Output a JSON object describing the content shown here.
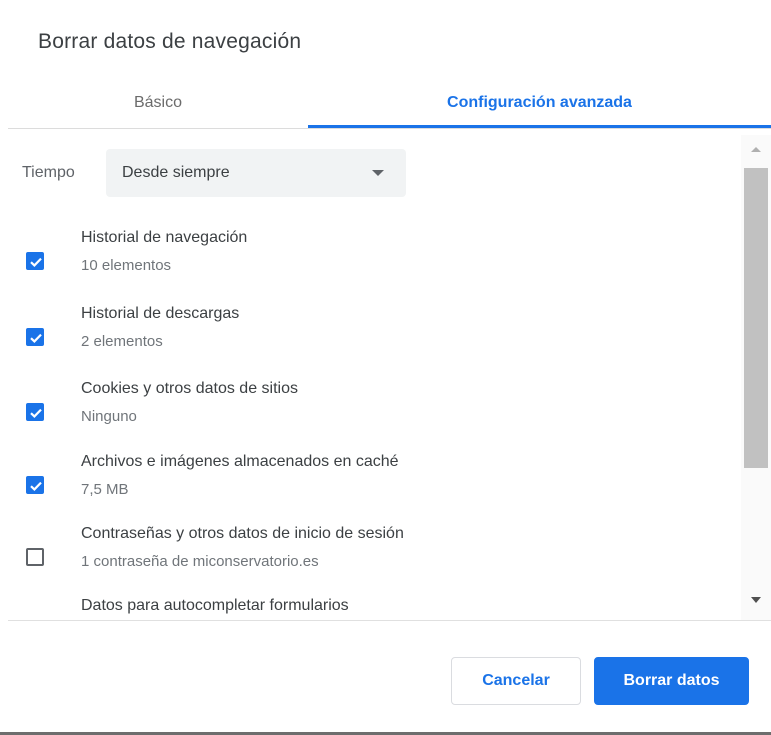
{
  "dialog": {
    "title": "Borrar datos de navegación"
  },
  "tabs": [
    {
      "label": "Básico",
      "active": false
    },
    {
      "label": "Configuración avanzada",
      "active": true
    }
  ],
  "time_range": {
    "label": "Tiempo",
    "selected": "Desde siempre"
  },
  "items": [
    {
      "title": "Historial de navegación",
      "subtitle": "10 elementos",
      "checked": true
    },
    {
      "title": "Historial de descargas",
      "subtitle": "2 elementos",
      "checked": true
    },
    {
      "title": "Cookies y otros datos de sitios",
      "subtitle": "Ninguno",
      "checked": true
    },
    {
      "title": "Archivos e imágenes almacenados en caché",
      "subtitle": "7,5 MB",
      "checked": true
    },
    {
      "title": "Contraseñas y otros datos de inicio de sesión",
      "subtitle": "1 contraseña de miconservatorio.es",
      "checked": false
    },
    {
      "title": "Datos para autocompletar formularios",
      "subtitle": "",
      "checked": false
    }
  ],
  "buttons": {
    "cancel_label": "Cancelar",
    "clear_label": "Borrar datos"
  },
  "colors": {
    "accent": "#1a73e8",
    "text": "#3c4043",
    "secondary_text": "#70757a"
  },
  "icons": {
    "checked": "checkmark-icon",
    "dropdown": "dropdown-arrow-icon"
  }
}
